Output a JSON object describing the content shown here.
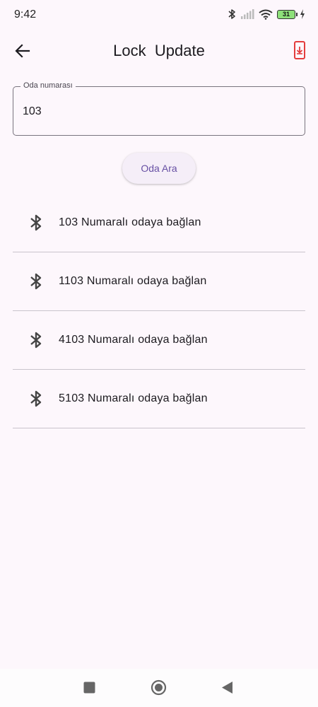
{
  "status_bar": {
    "time": "9:42",
    "battery_level": "31"
  },
  "app_bar": {
    "title": "Lock  Update"
  },
  "room_field": {
    "label": "Oda numarası",
    "value": "103"
  },
  "search_button": {
    "label": "Oda Ara"
  },
  "rooms": [
    {
      "label": "103 Numaralı odaya bağlan"
    },
    {
      "label": "1103 Numaralı odaya bağlan"
    },
    {
      "label": "4103 Numaralı odaya bağlan"
    },
    {
      "label": "5103 Numaralı odaya bağlan"
    }
  ],
  "icons": {
    "back": "arrow-left-icon",
    "download": "download-icon",
    "room": "bluetooth-icon",
    "nav_recents": "square-icon",
    "nav_home": "circle-icon",
    "nav_back": "triangle-back-icon"
  },
  "colors": {
    "background": "#fdf7fc",
    "accent": "#6750a4",
    "download_icon": "#e43d3d"
  }
}
